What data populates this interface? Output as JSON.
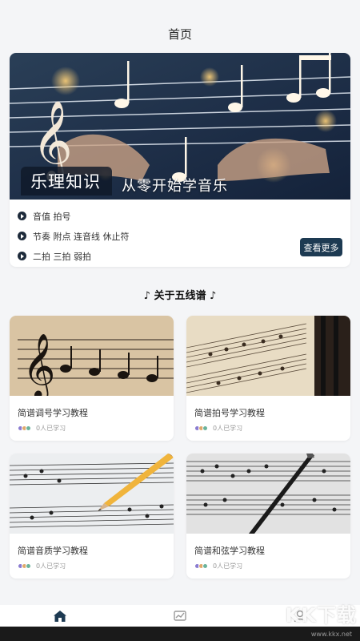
{
  "header": {
    "title": "首页"
  },
  "banner": {
    "title": "乐理知识",
    "subtitle": "从零开始学音乐",
    "items": [
      {
        "label": "音值 拍号"
      },
      {
        "label": "节奏 附点 连音线 休止符"
      },
      {
        "label": "二拍 三拍 弱拍"
      }
    ],
    "more_label": "查看更多"
  },
  "section": {
    "title": "♪ 关于五线谱 ♪"
  },
  "courses": [
    {
      "title": "简谱调号学习教程",
      "learners": "0人已学习"
    },
    {
      "title": "简谱拍号学习教程",
      "learners": "0人已学习"
    },
    {
      "title": "简谱音质学习教程",
      "learners": "0人已学习"
    },
    {
      "title": "简谱和弦学习教程",
      "learners": "0人已学习"
    }
  ],
  "tabbar": {
    "tabs": [
      {
        "icon": "home-icon",
        "active": true
      },
      {
        "icon": "chart-icon",
        "active": false
      },
      {
        "icon": "profile-icon",
        "active": false
      }
    ]
  },
  "watermark": {
    "text": "KK下载",
    "url": "www.kkx.net"
  },
  "colors": {
    "accent": "#1d3a52",
    "play_bullet": "#1d2a3a"
  }
}
